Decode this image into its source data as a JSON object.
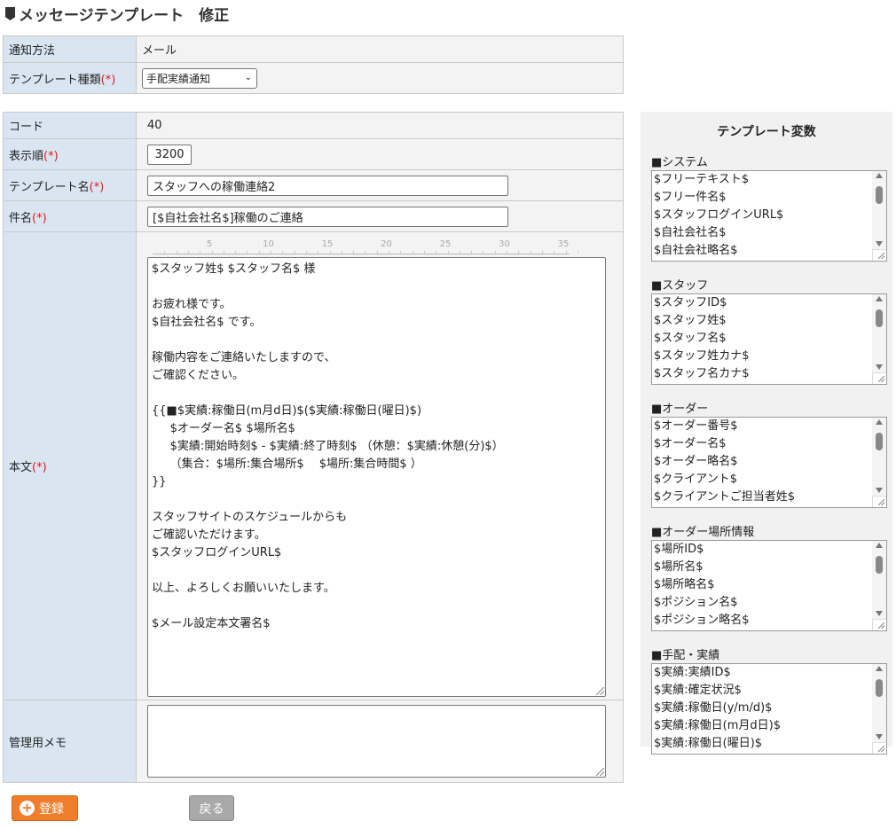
{
  "page": {
    "title": "メッセージテンプレート　修正"
  },
  "form_top": {
    "notify_label": "通知方法",
    "notify_value": "メール",
    "type_label": "テンプレート種類",
    "type_value": "手配実績通知"
  },
  "form": {
    "required_mark": "(*)",
    "code_label": "コード",
    "code_value": "40",
    "order_label": "表示順",
    "order_value": "3200",
    "name_label": "テンプレート名",
    "name_value": "スタッフへの稼働連絡2",
    "subject_label": "件名",
    "subject_value": "[$自社会社名$]稼働のご連絡",
    "body_label": "本文",
    "ruler": [
      "5",
      "10",
      "15",
      "20",
      "25",
      "30",
      "35"
    ],
    "body_lines": [
      "$スタッフ姓$ $スタッフ名$ 様",
      "",
      "お疲れ様です。",
      "$自社会社名$ です。",
      "",
      "稼働内容をご連絡いたしますので、",
      "ご確認ください。",
      "",
      "{{■$実績:稼働日(m月d日)$($実績:稼働日(曜日)$)",
      "     $オーダー名$ $場所名$",
      "     $実績:開始時刻$ - $実績:終了時刻$ （休憩：$実績:休憩(分)$）",
      "     （集合：$場所:集合場所$　 $場所:集合時間$ ）",
      "}}",
      "",
      "スタッフサイトのスケジュールからも",
      "ご確認いただけます。",
      "$スタッフログインURL$",
      "",
      "以上、よろしくお願いいたします。",
      "",
      "$メール設定本文署名$"
    ],
    "memo_label": "管理用メモ",
    "memo_value": ""
  },
  "variables": {
    "title": "テンプレート変数",
    "groups": [
      {
        "label": "■システム",
        "items": [
          "$フリーテキスト$",
          "$フリー件名$",
          "$スタッフログインURL$",
          "$自社会社名$",
          "$自社会社略名$"
        ]
      },
      {
        "label": "■スタッフ",
        "items": [
          "$スタッフID$",
          "$スタッフ姓$",
          "$スタッフ名$",
          "$スタッフ姓カナ$",
          "$スタッフ名カナ$"
        ]
      },
      {
        "label": "■オーダー",
        "items": [
          "$オーダー番号$",
          "$オーダー名$",
          "$オーダー略名$",
          "$クライアント$",
          "$クライアントご担当者姓$"
        ]
      },
      {
        "label": "■オーダー場所情報",
        "items": [
          "$場所ID$",
          "$場所名$",
          "$場所略名$",
          "$ポジション名$",
          "$ポジション略名$"
        ]
      },
      {
        "label": "■手配・実績",
        "items": [
          "$実績:実績ID$",
          "$実績:確定状況$",
          "$実績:稼働日(y/m/d)$",
          "$実績:稼働日(m月d日)$",
          "$実績:稼働日(曜日)$"
        ]
      }
    ]
  },
  "buttons": {
    "register": "登録",
    "back": "戻る"
  }
}
